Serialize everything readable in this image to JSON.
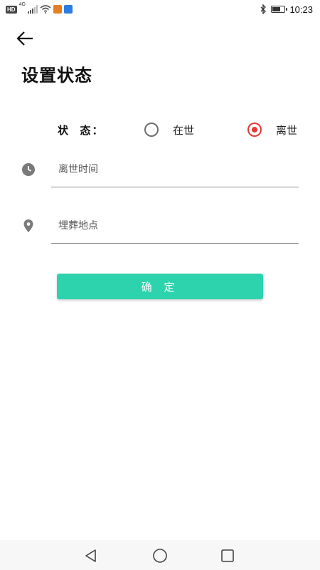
{
  "status_bar": {
    "hd_badge": "HD",
    "network": "4G",
    "time": "10:23",
    "battery_level": 0.7,
    "icons": [
      "hd-icon",
      "signal-icon",
      "wifi-icon",
      "app-notification-icon",
      "app-notification-icon",
      "bluetooth-icon",
      "battery-icon"
    ]
  },
  "header": {
    "back_icon": "arrow-left-icon",
    "title": "设置状态"
  },
  "form": {
    "status_label": "状  态：",
    "options": [
      {
        "label": "在世",
        "selected": false
      },
      {
        "label": "离世",
        "selected": true
      }
    ],
    "death_time": {
      "icon": "clock-icon",
      "placeholder": "离世时间",
      "value": ""
    },
    "burial_place": {
      "icon": "location-pin-icon",
      "placeholder": "埋葬地点",
      "value": ""
    },
    "confirm_label": "确 定"
  },
  "colors": {
    "accent": "#2dd3ad",
    "radio_selected": "#e53935",
    "radio_unselected": "#6e6e6e",
    "icon_gray": "#7a7a7a"
  },
  "nav_bar": {
    "buttons": [
      "back-triangle-icon",
      "home-circle-icon",
      "recents-square-icon"
    ]
  }
}
